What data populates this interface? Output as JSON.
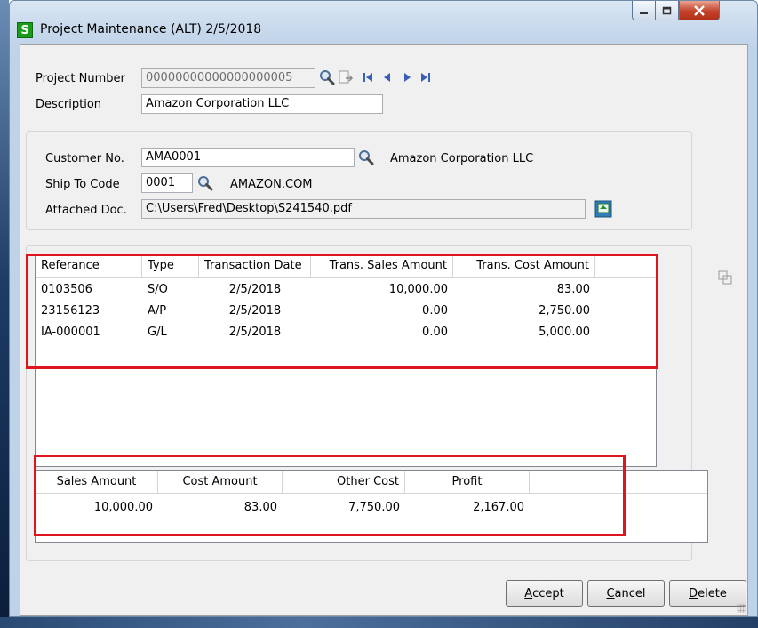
{
  "window": {
    "title": "Project Maintenance (ALT) 2/5/2018",
    "app_icon_letter": "S"
  },
  "header": {
    "project_number_label": "Project Number",
    "project_number_value": "00000000000000000005",
    "description_label": "Description",
    "description_value": "Amazon Corporation LLC"
  },
  "customer": {
    "customer_no_label": "Customer No.",
    "customer_no_value": "AMA0001",
    "customer_name": "Amazon Corporation LLC",
    "ship_to_label": "Ship To Code",
    "ship_to_value": "0001",
    "ship_to_name": "AMAZON.COM",
    "attached_doc_label": "Attached Doc.",
    "attached_doc_value": "C:\\Users\\Fred\\Desktop\\S241540.pdf"
  },
  "transactions": {
    "columns": [
      "Referance",
      "Type",
      "Transaction Date",
      "Trans. Sales Amount",
      "Trans. Cost Amount"
    ],
    "rows": [
      {
        "ref": "0103506",
        "type": "S/O",
        "date": "2/5/2018",
        "sales": "10,000.00",
        "cost": "83.00"
      },
      {
        "ref": "23156123",
        "type": "A/P",
        "date": "2/5/2018",
        "sales": "0.00",
        "cost": "2,750.00"
      },
      {
        "ref": "IA-000001",
        "type": "G/L",
        "date": "2/5/2018",
        "sales": "0.00",
        "cost": "5,000.00"
      }
    ]
  },
  "totals": {
    "columns": [
      "Sales Amount",
      "Cost Amount",
      "Other Cost",
      "Profit"
    ],
    "values": [
      "10,000.00",
      "83.00",
      "7,750.00",
      "2,167.00"
    ]
  },
  "buttons": {
    "accept_first": "A",
    "accept_rest": "ccept",
    "cancel_first": "C",
    "cancel_rest": "ancel",
    "delete_first": "D",
    "delete_rest": "elete"
  },
  "colors": {
    "highlight_box": "#e0141e",
    "app_icon": "#1a9b1a"
  }
}
